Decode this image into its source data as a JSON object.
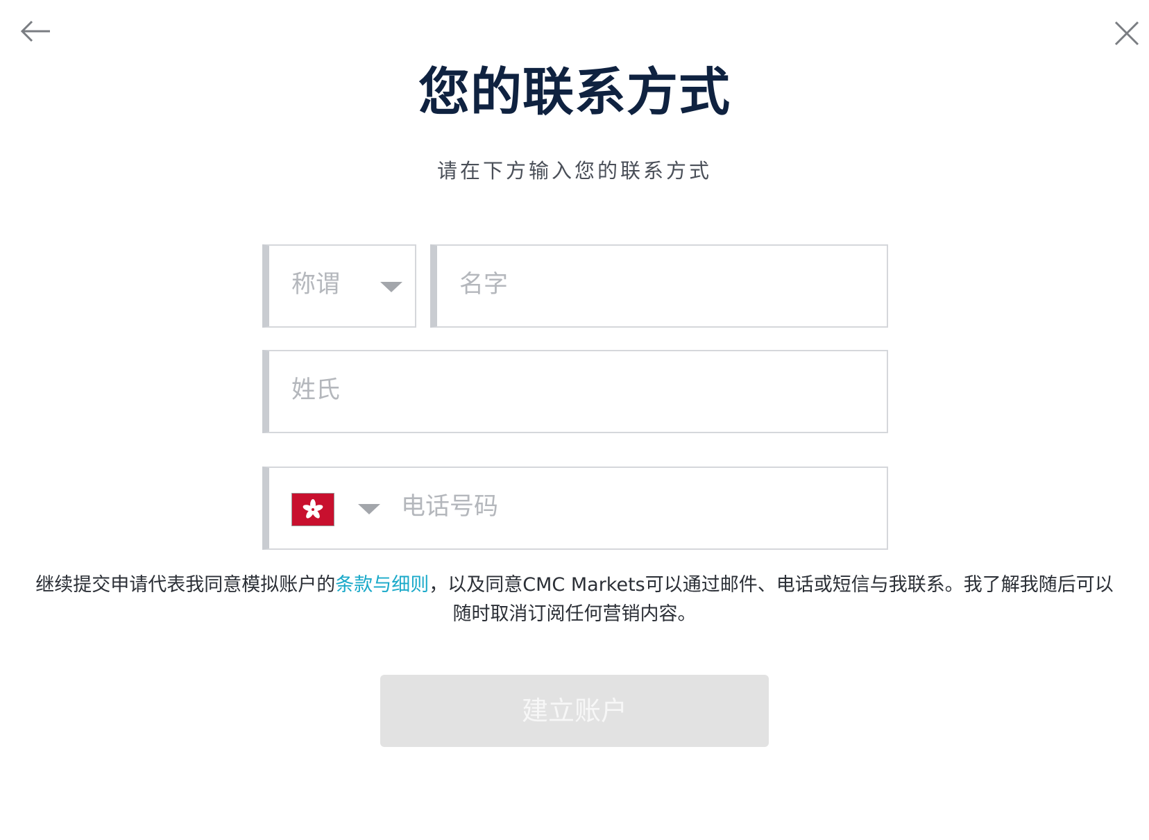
{
  "header": {
    "back_icon": "arrow-left-icon",
    "close_icon": "close-icon",
    "title": "您的联系方式",
    "subtitle": "请在下方输入您的联系方式"
  },
  "form": {
    "salutation": {
      "placeholder": "称谓",
      "icon": "chevron-down-icon"
    },
    "first_name": {
      "placeholder": "名字",
      "value": ""
    },
    "last_name": {
      "placeholder": "姓氏",
      "value": ""
    },
    "phone": {
      "country_flag_icon": "hong-kong-flag-icon",
      "placeholder": "电话号码",
      "value": ""
    }
  },
  "consent": {
    "prefix": "继续提交申请代表我同意模拟账户的",
    "link_text": "条款与细则",
    "suffix": "，以及同意CMC Markets可以通过邮件、电话或短信与我联系。我了解我随后可以随时取消订阅任何营销内容。"
  },
  "actions": {
    "submit_label": "建立账户"
  },
  "colors": {
    "title": "#0f2240",
    "link": "#1aa9c9",
    "button_disabled_bg": "#e2e2e2",
    "flag_red": "#c8102e"
  }
}
